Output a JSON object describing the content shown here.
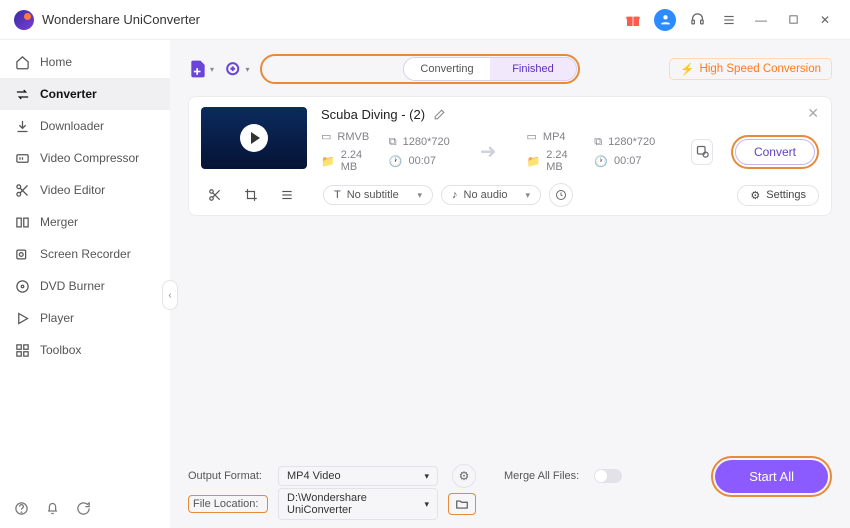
{
  "app": {
    "title": "Wondershare UniConverter"
  },
  "sidebar": {
    "items": [
      {
        "label": "Home"
      },
      {
        "label": "Converter"
      },
      {
        "label": "Downloader"
      },
      {
        "label": "Video Compressor"
      },
      {
        "label": "Video Editor"
      },
      {
        "label": "Merger"
      },
      {
        "label": "Screen Recorder"
      },
      {
        "label": "DVD Burner"
      },
      {
        "label": "Player"
      },
      {
        "label": "Toolbox"
      }
    ]
  },
  "tabs": {
    "converting": "Converting",
    "finished": "Finished"
  },
  "hsc_label": "High Speed Conversion",
  "file": {
    "title": "Scuba Diving - (2)",
    "src": {
      "container": "RMVB",
      "resolution": "1280*720",
      "size": "2.24 MB",
      "duration": "00:07"
    },
    "dst": {
      "container": "MP4",
      "resolution": "1280*720",
      "size": "2.24 MB",
      "duration": "00:07"
    },
    "convert_label": "Convert",
    "subtitle": "No subtitle",
    "audio": "No audio",
    "settings_label": "Settings"
  },
  "footer": {
    "output_format_label": "Output Format:",
    "output_format_value": "MP4 Video",
    "file_location_label": "File Location:",
    "file_location_value": "D:\\Wondershare UniConverter",
    "merge_label": "Merge All Files:",
    "start_all": "Start All"
  }
}
